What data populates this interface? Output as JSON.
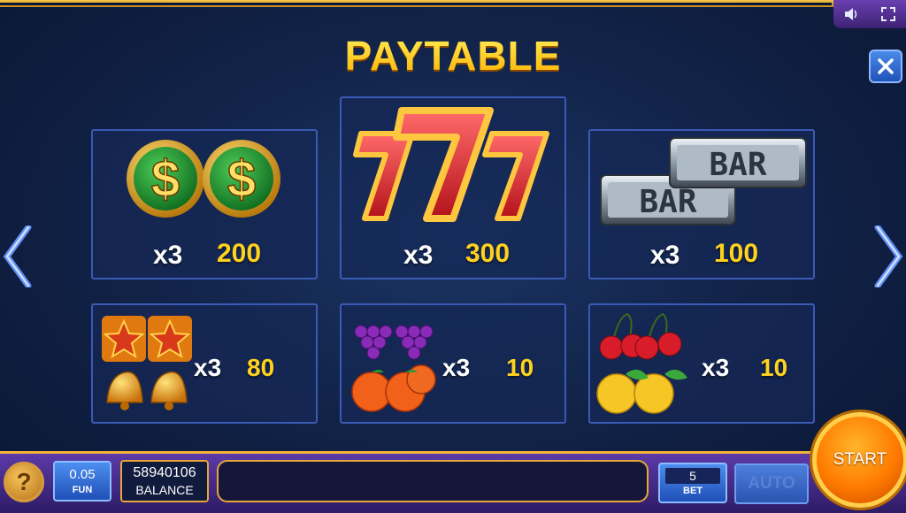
{
  "title": "PAYTABLE",
  "system_icons": [
    "speaker-icon",
    "fullscreen-icon"
  ],
  "paytable": [
    {
      "symbols": "dollar-coin",
      "multiplier": "x3",
      "payout": "200"
    },
    {
      "symbols": "lucky-seven",
      "multiplier": "x3",
      "payout": "300"
    },
    {
      "symbols": "bar",
      "bar_text": "BAR",
      "multiplier": "x3",
      "payout": "100"
    },
    {
      "symbols": "stars-and-bells",
      "multiplier": "x3",
      "payout": "80"
    },
    {
      "symbols": "grapes-and-oranges",
      "multiplier": "x3",
      "payout": "10"
    },
    {
      "symbols": "cherries-and-lemons",
      "multiplier": "x3",
      "payout": "10"
    }
  ],
  "bottom_bar": {
    "help_label": "?",
    "fun": {
      "value": "0.05",
      "label": "FUN"
    },
    "balance": {
      "value": "58940106",
      "label": "BALANCE"
    },
    "message": "",
    "bet": {
      "value": "5",
      "label": "BET"
    },
    "auto_label": "AUTO",
    "start_label": "START"
  },
  "colors": {
    "gold": "#ffd21f",
    "card_border": "#3a5ab4",
    "bottom_bar": "#4a2f90",
    "start": "#ff7b00"
  }
}
